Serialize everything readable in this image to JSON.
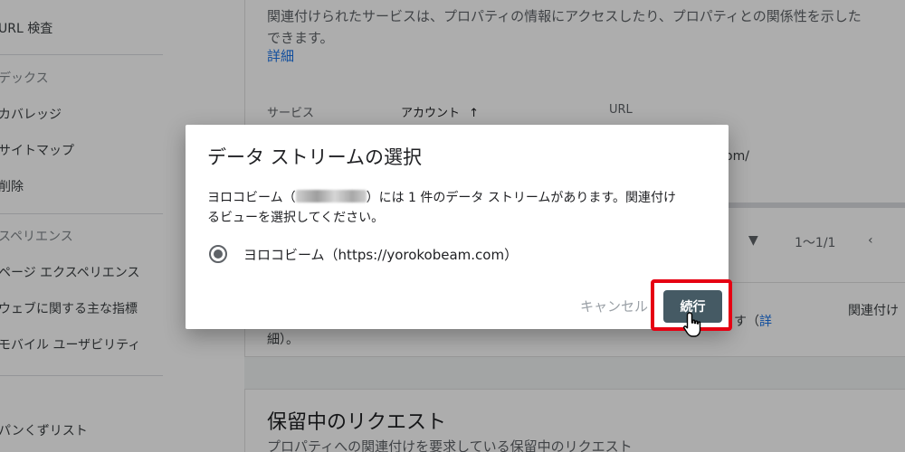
{
  "sidebar": {
    "url_inspection": "URL 検査",
    "index_section": "デックス",
    "coverage": "カバレッジ",
    "sitemaps": "サイトマップ",
    "removals": "削除",
    "experience_section": "スペリエンス",
    "page_experience": "ページ エクスペリエンス",
    "core_web_vitals": "ウェブに関する主な指標",
    "mobile_usability": "モバイル ユーザビリティ",
    "breadcrumbs": "パンくずリスト"
  },
  "main": {
    "description": "関連付けられたサービスは、プロパティの情報にアクセスしたり、プロパティとの関係性を示した",
    "description_line2": "できます。",
    "detail_link": "詳細",
    "columns": {
      "service": "サービス",
      "account": "アカウント",
      "account_sort_icon": "↑",
      "url": "URL"
    },
    "row_url_fragment": "om/",
    "pager_range": "1〜1/1",
    "lower_text_fragment": "す（",
    "lower_link_fragment": "詳",
    "lower_text_line2": "細）。",
    "lower_right_label": "関連付け"
  },
  "pending": {
    "title": "保留中のリクエスト",
    "description": "プロパティへの関連付けを要求している保留中のリクエスト"
  },
  "dialog": {
    "title": "データ ストリームの選択",
    "body_prefix": "ヨロコビーム（",
    "body_suffix": "）には 1 件のデータ ストリームがあります。関連付け",
    "body_line2": "るビューを選択してください。",
    "option_label": "ヨロコビーム（https://yorokobeam.com）",
    "option_selected": true,
    "cancel_label": "キャンセル",
    "continue_label": "続行"
  },
  "colors": {
    "highlight": "#e60012",
    "continue_button": "#455a64",
    "link": "#1a73e8"
  },
  "icons": {
    "sort": "arrow-up-icon",
    "dropdown": "caret-down-icon",
    "prev": "chevron-left-icon",
    "cursor": "hand-pointer-icon"
  }
}
